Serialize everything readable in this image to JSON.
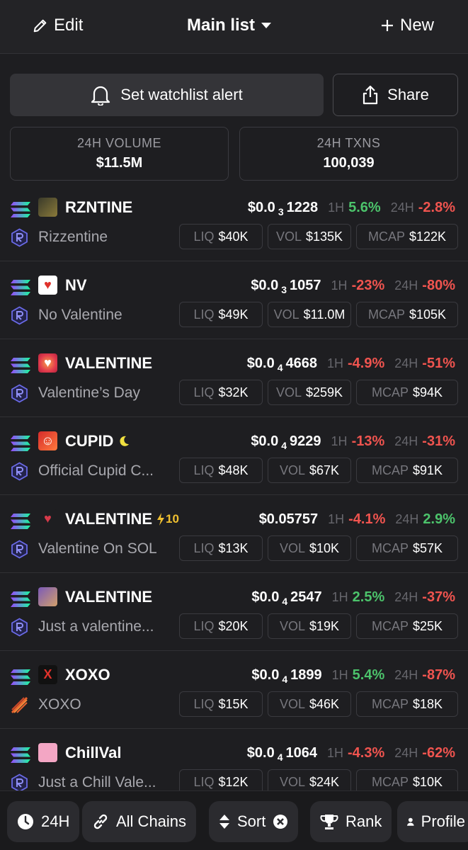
{
  "header": {
    "edit_label": "Edit",
    "list_title": "Main list",
    "new_label": "New"
  },
  "actions": {
    "alert_label": "Set watchlist alert",
    "share_label": "Share"
  },
  "stats": [
    {
      "label": "24H VOLUME",
      "value": "$11.5M"
    },
    {
      "label": "24H TXNS",
      "value": "100,039"
    }
  ],
  "labels": {
    "h1": "1H",
    "h24": "24H",
    "liq": "LIQ",
    "vol": "VOL",
    "mcap": "MCAP"
  },
  "tokens": [
    {
      "symbol": "RZNTINE",
      "name": "Rizzentine",
      "price_prefix": "$0.0",
      "price_zeros": "3",
      "price_digits": "1228",
      "ch_1h": "5.6%",
      "ch_24h": "-2.8%",
      "liq": "$40K",
      "vol": "$135K",
      "mcap": "$122K"
    },
    {
      "symbol": "NV",
      "name": "No Valentine",
      "price_prefix": "$0.0",
      "price_zeros": "3",
      "price_digits": "1057",
      "ch_1h": "-23%",
      "ch_24h": "-80%",
      "liq": "$49K",
      "vol": "$11.0M",
      "mcap": "$105K"
    },
    {
      "symbol": "VALENTINE",
      "name": "Valentine’s Day",
      "price_prefix": "$0.0",
      "price_zeros": "4",
      "price_digits": "4668",
      "ch_1h": "-4.9%",
      "ch_24h": "-51%",
      "liq": "$32K",
      "vol": "$259K",
      "mcap": "$94K"
    },
    {
      "symbol": "CUPID",
      "name": "Official Cupid C...",
      "price_prefix": "$0.0",
      "price_zeros": "4",
      "price_digits": "9229",
      "ch_1h": "-13%",
      "ch_24h": "-31%",
      "liq": "$48K",
      "vol": "$67K",
      "mcap": "$91K"
    },
    {
      "symbol": "VALENTINE",
      "badge": "10",
      "name": "Valentine On SOL",
      "price_prefix": "$0.05757",
      "price_zeros": "",
      "price_digits": "",
      "ch_1h": "-4.1%",
      "ch_24h": "2.9%",
      "liq": "$13K",
      "vol": "$10K",
      "mcap": "$57K"
    },
    {
      "symbol": "VALENTINE",
      "name": "Just a valentine...",
      "price_prefix": "$0.0",
      "price_zeros": "4",
      "price_digits": "2547",
      "ch_1h": "2.5%",
      "ch_24h": "-37%",
      "liq": "$20K",
      "vol": "$19K",
      "mcap": "$25K"
    },
    {
      "symbol": "XOXO",
      "name": "XOXO",
      "price_prefix": "$0.0",
      "price_zeros": "4",
      "price_digits": "1899",
      "ch_1h": "5.4%",
      "ch_24h": "-87%",
      "liq": "$15K",
      "vol": "$46K",
      "mcap": "$18K"
    },
    {
      "symbol": "ChillVal",
      "name": "Just a Chill Vale...",
      "price_prefix": "$0.0",
      "price_zeros": "4",
      "price_digits": "1064",
      "ch_1h": "-4.3%",
      "ch_24h": "-62%",
      "liq": "$12K",
      "vol": "$24K",
      "mcap": "$10K"
    }
  ],
  "bottom_bar": {
    "timeframe": "24H",
    "chains": "All Chains",
    "sort": "Sort",
    "rank": "Rank",
    "profile": "Profile"
  },
  "colors": {
    "up": "#4cc36b",
    "down": "#f0544f",
    "background": "#1e1e21"
  }
}
